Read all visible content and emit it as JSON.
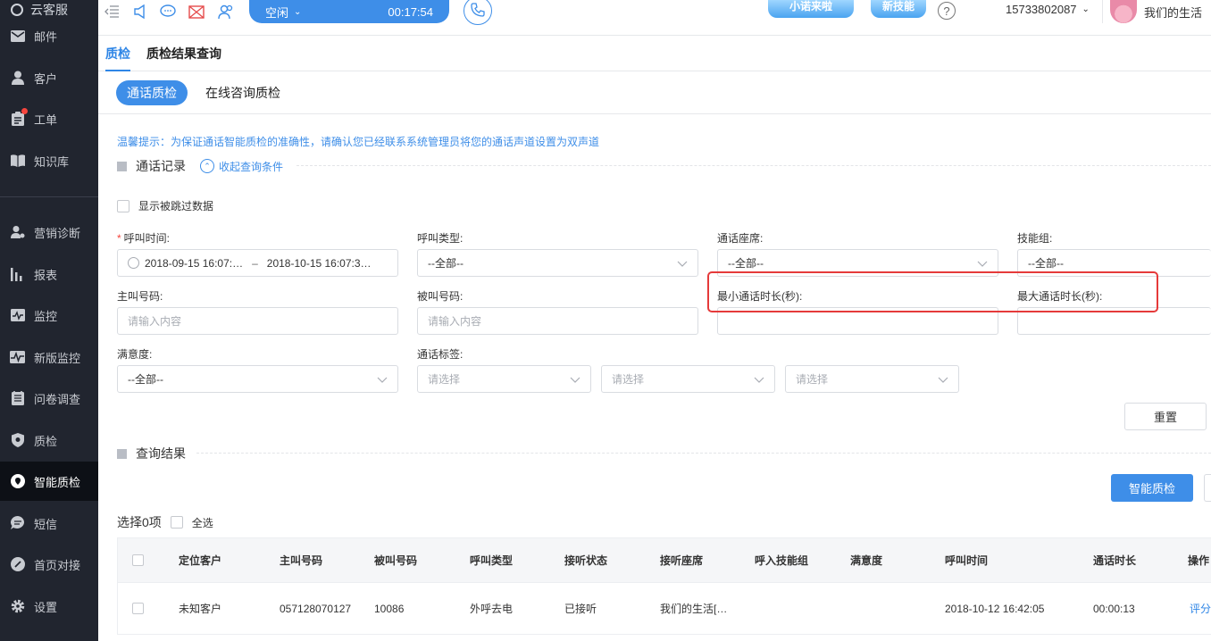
{
  "app": {
    "brand": "云客服"
  },
  "sidebar": {
    "items": [
      {
        "label": "邮件",
        "icon": "mail-icon"
      },
      {
        "label": "客户",
        "icon": "user-icon"
      },
      {
        "label": "工单",
        "icon": "clipboard-icon"
      },
      {
        "label": "知识库",
        "icon": "book-icon"
      },
      {
        "label": "营销诊断",
        "icon": "marketing-icon"
      },
      {
        "label": "报表",
        "icon": "bar-chart-icon"
      },
      {
        "label": "监控",
        "icon": "monitor-icon"
      },
      {
        "label": "新版监控",
        "icon": "pulse-icon"
      },
      {
        "label": "问卷调查",
        "icon": "survey-icon"
      },
      {
        "label": "质检",
        "icon": "shield-icon"
      },
      {
        "label": "智能质检",
        "icon": "smart-qc-icon"
      },
      {
        "label": "短信",
        "icon": "sms-icon"
      },
      {
        "label": "首页对接",
        "icon": "link-icon"
      },
      {
        "label": "设置",
        "icon": "gear-icon"
      }
    ],
    "active": "智能质检"
  },
  "topbar": {
    "status": "空闲",
    "timer": "00:17:54",
    "promo1": "小诺来啦",
    "promo2": "新技能",
    "account": "15733802087",
    "username": "我们的生活"
  },
  "page_tabs": [
    "质检",
    "质检结果查询"
  ],
  "sub_tabs": {
    "active": "通话质检",
    "other": "在线咨询质检"
  },
  "tip": "温馨提示：为保证通话智能质检的准确性，请确认您已经联系系统管理员将您的通话声道设置为双声道",
  "section_records": {
    "title": "通话记录",
    "collapse": "收起查询条件"
  },
  "show_skipped": "显示被跳过数据",
  "filters": {
    "call_time": {
      "label": "呼叫时间:",
      "start": "2018-09-15 16:07:…",
      "end": "2018-10-15 16:07:3…"
    },
    "call_type": {
      "label": "呼叫类型:",
      "value": "--全部--"
    },
    "agent": {
      "label": "通话座席:",
      "value": "--全部--"
    },
    "skill_group": {
      "label": "技能组:",
      "value": "--全部--"
    },
    "caller": {
      "label": "主叫号码:",
      "placeholder": "请输入内容"
    },
    "callee": {
      "label": "被叫号码:",
      "placeholder": "请输入内容"
    },
    "min_duration": {
      "label": "最小通话时长(秒):"
    },
    "max_duration": {
      "label": "最大通话时长(秒):"
    },
    "satisfaction": {
      "label": "满意度:",
      "value": "--全部--"
    },
    "call_tag": {
      "label": "通话标签:",
      "placeholder1": "请选择",
      "placeholder2": "请选择",
      "placeholder3": "请选择"
    }
  },
  "reset_button": "重置",
  "section_results": {
    "title": "查询结果"
  },
  "smart_qc_button": "智能质检",
  "selection": {
    "count": "选择0项",
    "select_all": "全选"
  },
  "table": {
    "headers": [
      "定位客户",
      "主叫号码",
      "被叫号码",
      "呼叫类型",
      "接听状态",
      "接听座席",
      "呼入技能组",
      "满意度",
      "呼叫时间",
      "通话时长",
      "操作"
    ],
    "rows": [
      {
        "customer": "未知客户",
        "caller": "057128070127",
        "callee": "10086",
        "call_type": "外呼去电",
        "status": "已接听",
        "agent": "我们的生活[…",
        "skill_group": "",
        "satisfaction": "",
        "time": "2018-10-12 16:42:05",
        "duration": "00:00:13",
        "action": "评分"
      }
    ]
  }
}
